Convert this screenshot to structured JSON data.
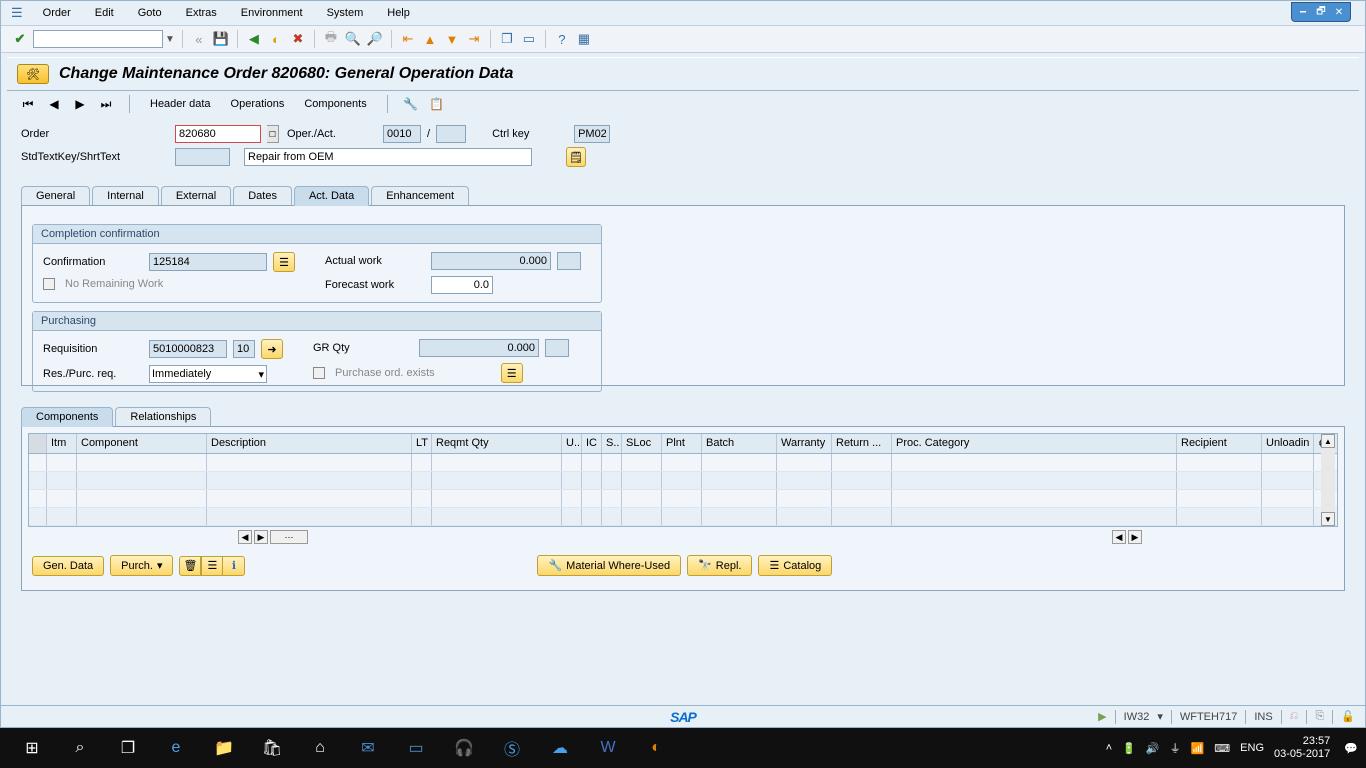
{
  "window": {
    "min_icon": "🗕",
    "max_icon": "🗗",
    "close_icon": "✕"
  },
  "menu": {
    "items": [
      "Order",
      "Edit",
      "Goto",
      "Extras",
      "Environment",
      "System",
      "Help"
    ]
  },
  "title": "Change Maintenance Order 820680: General Operation Data",
  "nav": {
    "header_data": "Header data",
    "operations": "Operations",
    "components": "Components"
  },
  "header_fields": {
    "order_label": "Order",
    "order_value": "820680",
    "oper_label": "Oper./Act.",
    "oper_value": "0010",
    "oper_sep": "/",
    "oper_sub": "",
    "ctrlkey_label": "Ctrl key",
    "ctrlkey_value": "PM02",
    "stdkey_label": "StdTextKey/ShrtText",
    "stdkey_value": "",
    "shorttext_value": "Repair from OEM"
  },
  "tabs": [
    "General",
    "Internal",
    "External",
    "Dates",
    "Act. Data",
    "Enhancement"
  ],
  "active_tab": "Act. Data",
  "group_completion": {
    "title": "Completion confirmation",
    "confirmation_label": "Confirmation",
    "confirmation_value": "125184",
    "no_remaining_label": "No Remaining Work",
    "actual_work_label": "Actual work",
    "actual_work_value": "0.000",
    "actual_work_unit": "",
    "forecast_label": "Forecast work",
    "forecast_value": "0.0"
  },
  "group_purchasing": {
    "title": "Purchasing",
    "requisition_label": "Requisition",
    "requisition_value": "5010000823",
    "requisition_item": "10",
    "respurc_label": "Res./Purc. req.",
    "respurc_value": "Immediately",
    "grqty_label": "GR Qty",
    "grqty_value": "0.000",
    "grqty_unit": "",
    "po_exists_label": "Purchase ord. exists"
  },
  "lower_tabs": [
    "Components",
    "Relationships"
  ],
  "active_lower_tab": "Components",
  "grid": {
    "columns": [
      "Itm",
      "Component",
      "Description",
      "LT",
      "Reqmt Qty",
      "U..",
      "IC",
      "S..",
      "SLoc",
      "Plnt",
      "Batch",
      "Warranty",
      "Return ...",
      "Proc. Category",
      "Recipient",
      "Unloadin"
    ],
    "rows": [
      {},
      {},
      {},
      {}
    ]
  },
  "bottom_buttons": {
    "gendata": "Gen. Data",
    "purch": "Purch.",
    "material_where": "Material Where-Used",
    "repl": "Repl.",
    "catalog": "Catalog"
  },
  "status": {
    "tcode": "IW32",
    "host": "WFTEH717",
    "ins": "INS"
  },
  "taskbar": {
    "lang": "ENG",
    "time": "23:57",
    "date": "03-05-2017"
  }
}
